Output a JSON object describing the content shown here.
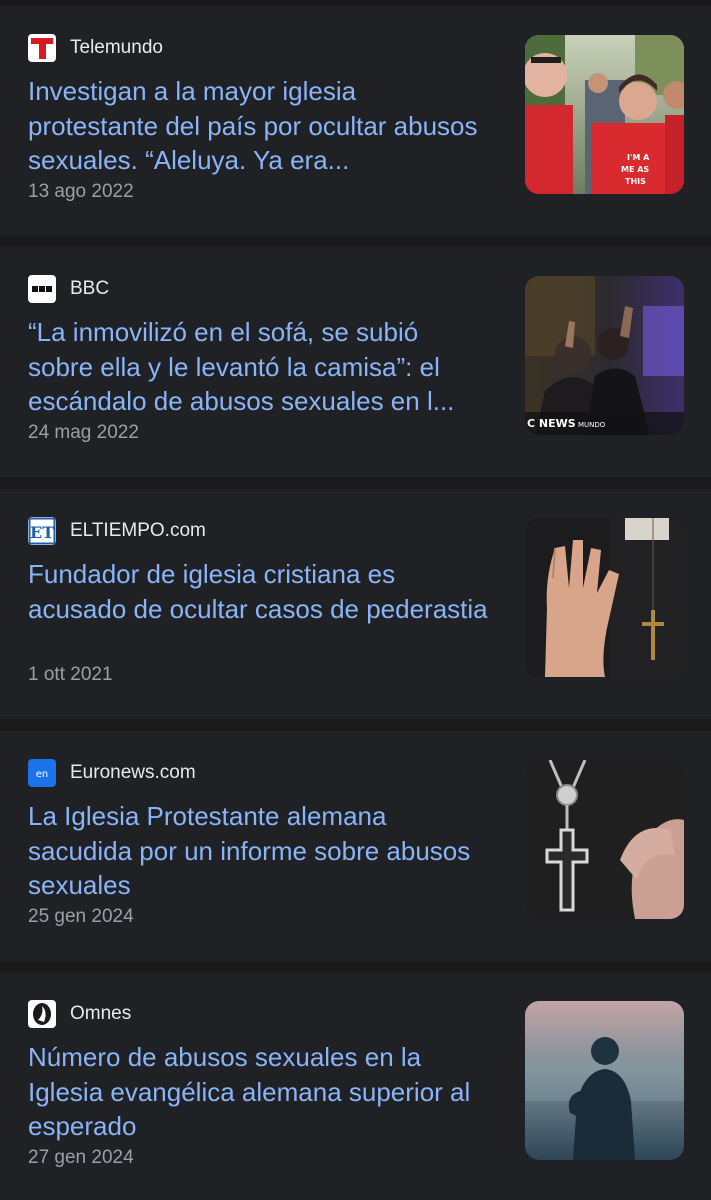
{
  "articles": [
    {
      "source": "Telemundo",
      "logo_icon": "telemundo-logo",
      "headline": "Investigan a la mayor iglesia protestante del país por ocultar abusos sexuales. “Aleluya. Ya era...",
      "date": "13 ago 2022",
      "thumbnail": "protest-crowd-photo",
      "thumbnail_text": "I'M A ME AS THIS"
    },
    {
      "source": "BBC",
      "logo_icon": "bbc-logo",
      "headline": "“La inmovilizó en el sofá, se subió sobre ella y le levantó la camisa”: el escándalo de abusos sexuales en l...",
      "date": "24 mag 2022",
      "thumbnail": "church-worship-photo",
      "thumbnail_text": "C NEWS MUNDO"
    },
    {
      "source": "ELTIEMPO.com",
      "logo_icon": "eltiempo-logo",
      "logo_text": "ET",
      "headline": "Fundador de iglesia cristiana es acusado de ocultar casos de pederastia",
      "date": "1 ott 2021",
      "thumbnail": "raised-hand-cross-photo"
    },
    {
      "source": "Euronews.com",
      "logo_icon": "euronews-logo",
      "logo_text": "en",
      "headline": "La Iglesia Protestante alemana sacudida por un informe sobre abusos sexuales",
      "date": "25 gen 2024",
      "thumbnail": "pectoral-cross-photo"
    },
    {
      "source": "Omnes",
      "logo_icon": "omnes-logo",
      "headline": "Número de abusos sexuales en la Iglesia evangélica alemana superior al esperado",
      "date": "27 gen 2024",
      "thumbnail": "silhouette-fog-photo"
    }
  ],
  "colors": {
    "background": "#1a1a1a",
    "card": "#202124",
    "headline": "#8ab4f8",
    "source": "#e8eaed",
    "date": "#9aa0a6"
  }
}
